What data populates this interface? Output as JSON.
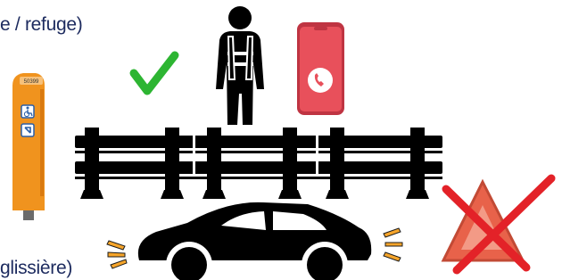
{
  "captions": {
    "top": "e / refuge)",
    "bottom": "glissière)"
  },
  "emergency_phone": {
    "number": "50399",
    "icons": [
      "wheelchair-icon",
      "emergency-exit-icon"
    ]
  },
  "scene_icons": [
    "checkmark-icon",
    "safety-vest-person-icon",
    "smartphone-call-icon",
    "guardrail-icon",
    "car-with-hazard-lights-icon",
    "warning-triangle-crossed-icon"
  ],
  "colors": {
    "caption": "#1c2a5e",
    "check": "#2db532",
    "phone": "#e8505b",
    "pillar": "#f0931e",
    "cross": "#e32228",
    "triangle": "#e8624a",
    "hazard": "#f6a52a"
  }
}
